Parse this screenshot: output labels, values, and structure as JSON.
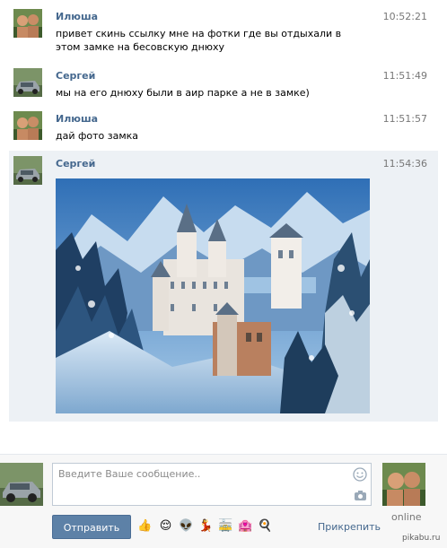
{
  "messages": [
    {
      "author": "Илюша",
      "time": "10:52:21",
      "text": "привет скинь ссылку мне на фотки где вы отдыхали в этом замке на бесовскую днюху"
    },
    {
      "author": "Сергей",
      "time": "11:51:49",
      "text": "мы на его днюху были в аир парке а не в замке)"
    },
    {
      "author": "Илюша",
      "time": "11:51:57",
      "text": "дай фото замка"
    },
    {
      "author": "Сергей",
      "time": "11:54:36",
      "text": ""
    }
  ],
  "composer": {
    "placeholder": "Введите Ваше сообщение..",
    "send_label": "Отправить",
    "attach_label": "Прикрепить",
    "online_label": "online",
    "emojis": [
      "👍",
      "😌",
      "👽",
      "💃",
      "🚋",
      "🏩",
      "🍳"
    ]
  },
  "watermark": "pikabu.ru",
  "colors": {
    "author": "#45688e",
    "highlight": "#edf1f5",
    "send_button": "#5d81a7"
  }
}
